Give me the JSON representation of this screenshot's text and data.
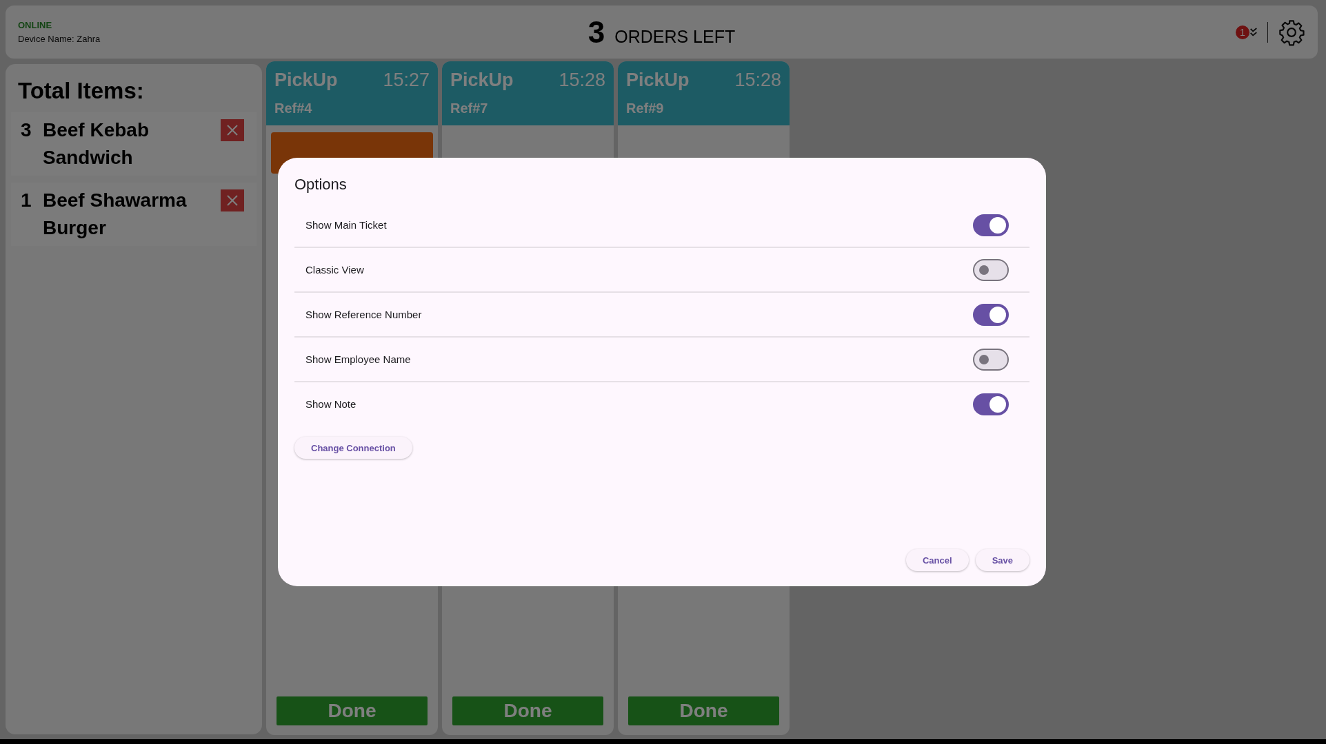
{
  "header": {
    "status": "ONLINE",
    "device_name": "Device Name: Zahra",
    "orders_count": "3",
    "orders_label": "ORDERS LEFT",
    "notification_count": "1"
  },
  "sidebar": {
    "title": "Total Items:",
    "items": [
      {
        "qty": "3",
        "name": "Beef Kebab Sandwich"
      },
      {
        "qty": "1",
        "name": "Beef Shawarma Burger"
      }
    ]
  },
  "orders": [
    {
      "type": "PickUp",
      "time": "15:27",
      "ref": "Ref#4",
      "banner": true,
      "done": "Done"
    },
    {
      "type": "PickUp",
      "time": "15:28",
      "ref": "Ref#7",
      "banner": false,
      "done": "Done"
    },
    {
      "type": "PickUp",
      "time": "15:28",
      "ref": "Ref#9",
      "banner": false,
      "done": "Done"
    }
  ],
  "dialog": {
    "title": "Options",
    "options": [
      {
        "label": "Show Main Ticket",
        "on": true
      },
      {
        "label": "Classic View",
        "on": false
      },
      {
        "label": "Show Reference Number",
        "on": true
      },
      {
        "label": "Show Employee Name",
        "on": false
      },
      {
        "label": "Show Note",
        "on": true
      }
    ],
    "link_button": "Change Connection",
    "buttons": [
      "Cancel",
      "Save"
    ]
  }
}
